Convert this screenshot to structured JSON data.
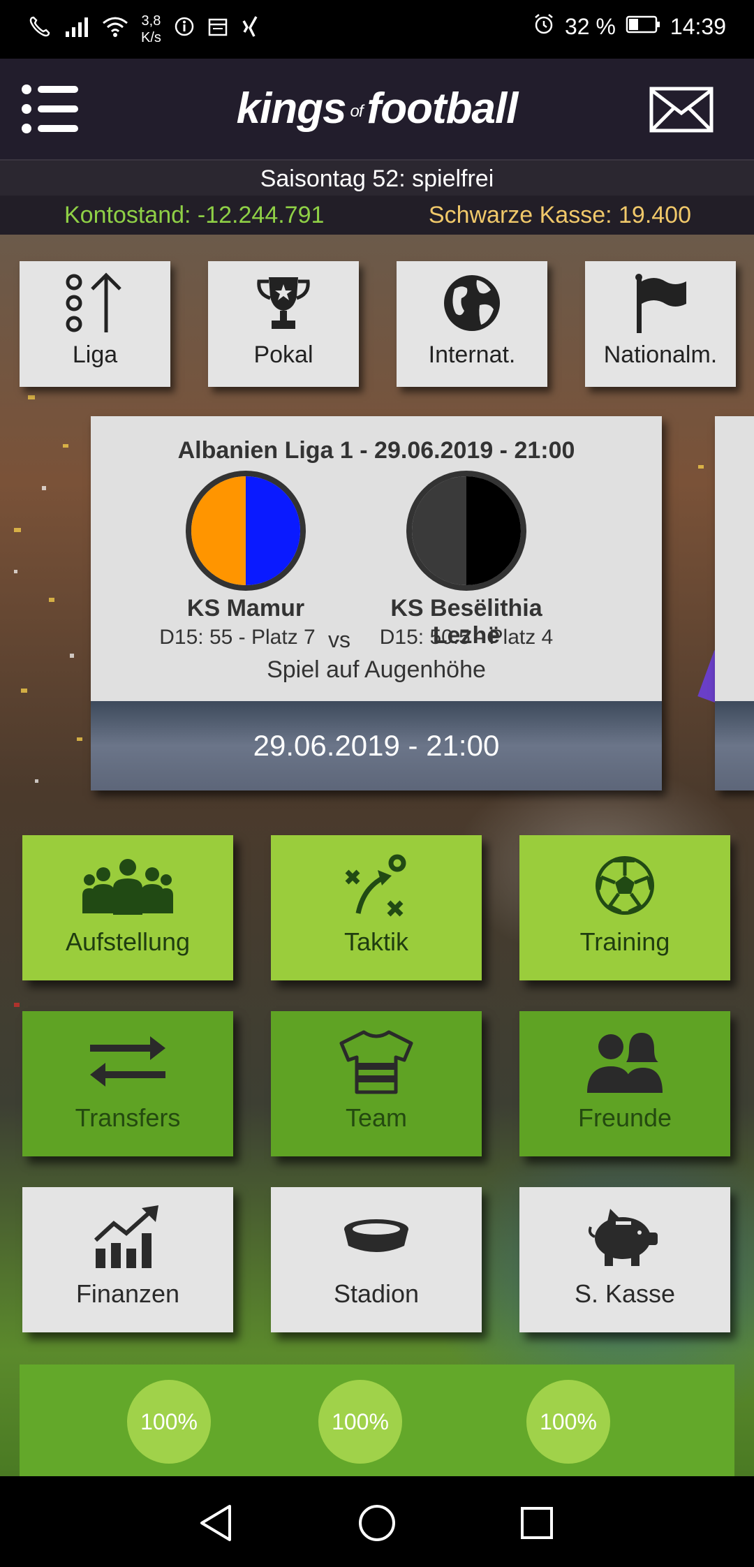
{
  "status_bar": {
    "speed_value": "3,8",
    "speed_unit": "K/s",
    "battery": "32 %",
    "time": "14:39"
  },
  "app_bar": {
    "logo_left": "kings",
    "logo_of": "of",
    "logo_right": "football"
  },
  "info": {
    "season_day": "Saisontag 52: spielfrei",
    "account_balance": "Kontostand: -12.244.791",
    "black_cash": "Schwarze Kasse: 19.400"
  },
  "top_buttons": [
    {
      "label": "Liga",
      "icon": "league-table-icon"
    },
    {
      "label": "Pokal",
      "icon": "trophy-icon"
    },
    {
      "label": "Internat.",
      "icon": "globe-icon"
    },
    {
      "label": "Nationalm.",
      "icon": "flag-icon"
    }
  ],
  "match": {
    "title": "Albanien Liga 1 - 29.06.2019 - 21:00",
    "home_name": "KS Mamur",
    "home_info": "D15: 55 - Platz 7",
    "home_colors": [
      "#ff9500",
      "#0a1aff"
    ],
    "vs": "vs",
    "away_name": "KS Besëlithia Lezhë",
    "away_info": "D15: 50.5 - Platz 4",
    "away_colors": [
      "#3a3a3a",
      "#000000"
    ],
    "note": "Spiel auf Augenhöhe",
    "date": "29.06.2019 - 21:00"
  },
  "tiles": [
    {
      "label": "Aufstellung",
      "icon": "team-lineup-icon"
    },
    {
      "label": "Taktik",
      "icon": "tactics-icon"
    },
    {
      "label": "Training",
      "icon": "soccer-ball-icon"
    },
    {
      "label": "Transfers",
      "icon": "transfer-arrows-icon"
    },
    {
      "label": "Team",
      "icon": "jersey-icon"
    },
    {
      "label": "Freunde",
      "icon": "friends-icon"
    },
    {
      "label": "Finanzen",
      "icon": "finance-chart-icon"
    },
    {
      "label": "Stadion",
      "icon": "stadium-icon"
    },
    {
      "label": "S. Kasse",
      "icon": "piggy-bank-icon"
    }
  ],
  "percentages": [
    "100%",
    "100%",
    "100%"
  ]
}
